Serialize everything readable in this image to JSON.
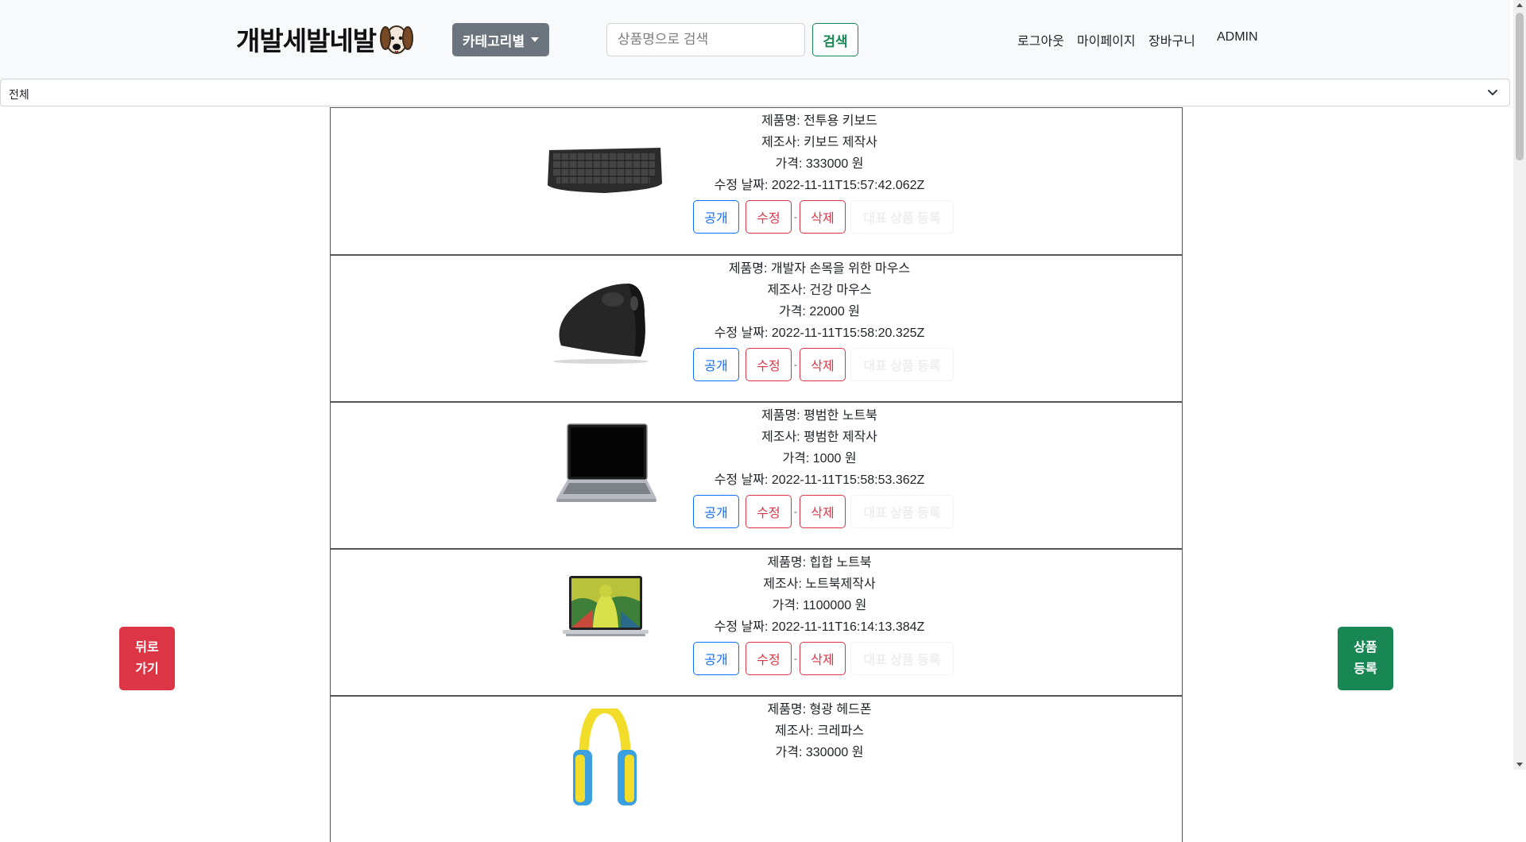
{
  "header": {
    "logo_text": "개발세발네발",
    "category_button": "카테고리별",
    "search": {
      "placeholder": "상품명으로 검색",
      "value": "",
      "button": "검색"
    },
    "nav": {
      "logout": "로그아웃",
      "mypage": "마이페이지",
      "cart": "장바구니",
      "admin": "ADMIN"
    }
  },
  "category_select": {
    "selected": "전체"
  },
  "labels": {
    "name": "제품명:",
    "maker": "제조사:",
    "price": "가격:",
    "currency": "원",
    "updated": "수정 날짜:",
    "public_btn": "공개",
    "edit_btn": "수정",
    "delete_btn": "삭제",
    "separator": "-",
    "rep_btn": "대표 상품 등록"
  },
  "products": [
    {
      "image_icon": "keyboard-image",
      "name": "전투용 키보드",
      "maker": "키보드 제작사",
      "price": "333000",
      "updated": "2022-11-11T15:57:42.062Z"
    },
    {
      "image_icon": "mouse-image",
      "name": "개발자 손목을 위한 마우스",
      "maker": "건강 마우스",
      "price": "22000",
      "updated": "2022-11-11T15:58:20.325Z"
    },
    {
      "image_icon": "laptop-image",
      "name": "평범한 노트북",
      "maker": "평범한 제작사",
      "price": "1000",
      "updated": "2022-11-11T15:58:53.362Z"
    },
    {
      "image_icon": "macbook-image",
      "name": "힙합 노트북",
      "maker": "노트북제작사",
      "price": "1100000",
      "updated": "2022-11-11T16:14:13.384Z"
    },
    {
      "image_icon": "headphone-image",
      "name": "형광 헤드폰",
      "maker": "크레파스",
      "price": "330000",
      "updated": ""
    }
  ],
  "floating": {
    "back_line1": "뒤로",
    "back_line2": "가기",
    "register_line1": "상품",
    "register_line2": "등록"
  },
  "colors": {
    "primary": "#0d6efd",
    "danger": "#dc3545",
    "success": "#198754",
    "secondary": "#6c757d",
    "header_bg": "#f8f9fa"
  }
}
